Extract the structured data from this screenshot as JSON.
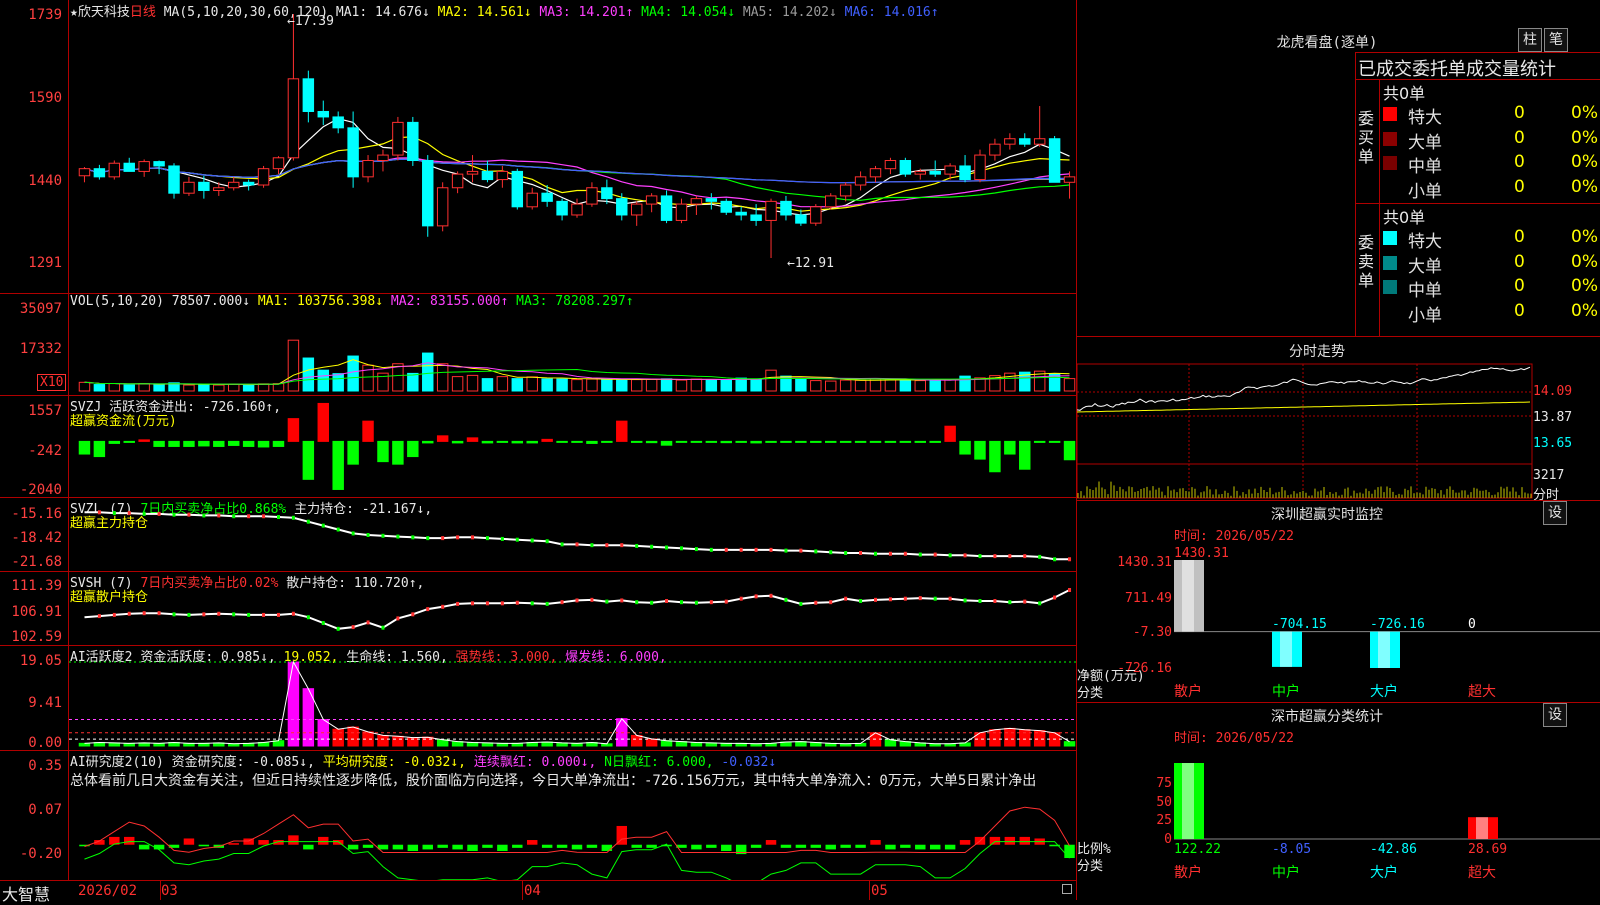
{
  "header": {
    "star": "★",
    "stock_name": "欣天科技",
    "period": "日线",
    "ma_params": "MA(5,10,20,30,60,120)",
    "ma1": "MA1: 14.676↓",
    "ma2": "MA2: 14.561↓",
    "ma3": "MA3: 14.201↑",
    "ma4": "MA4: 14.054↓",
    "ma5": "MA5: 14.202↓",
    "ma6": "MA6: 14.016↑"
  },
  "price_axis": [
    "1739",
    "1590",
    "1440",
    "1291"
  ],
  "price_annotations": {
    "high": "←17.39",
    "low": "←12.91"
  },
  "vol": {
    "head": "VOL(5,10,20)",
    "value": "78507.000↓",
    "ma1": "MA1: 103756.398↓",
    "ma2": "MA2: 83155.000↑",
    "ma3": "MA3: 78208.297↑",
    "axis": [
      "35097",
      "17332"
    ],
    "unit": "X10"
  },
  "svzj": {
    "head": "SVZJ",
    "value": "活跃资金进出: -726.160↑,",
    "subtitle": "超赢资金流(万元)",
    "axis": [
      "1557",
      "-242",
      "-2040"
    ]
  },
  "svzl": {
    "head": "SVZL (7)",
    "ratio": "7日内买卖净占比0.868%",
    "hold": "主力持仓: -21.167↓,",
    "subtitle": "超赢主力持仓",
    "axis": [
      "-15.16",
      "-18.42",
      "-21.68"
    ]
  },
  "svsh": {
    "head": "SVSH (7)",
    "ratio": "7日内买卖净占比0.02%",
    "hold": "散户持仓: 110.720↑,",
    "subtitle": "超赢散户持仓",
    "axis": [
      "111.39",
      "106.91",
      "102.59"
    ]
  },
  "ai_active": {
    "head": "AI活跃度2",
    "v1": "资金活跃度: 0.985↓,",
    "v2": "19.052,",
    "v3": "生命线: 1.560,",
    "v4": "强势线: 3.000,",
    "v5": "爆发线: 6.000,",
    "axis": [
      "19.05",
      "9.41",
      "0.00"
    ]
  },
  "ai_research": {
    "head": "AI研究度2(10)",
    "v1": "资金研究度: -0.085↓,",
    "v2": "平均研究度: -0.032↓,",
    "v3": "连续飘红: 0.000↓,",
    "v4": "N日飘红: 6.000,",
    "v5": "-0.032↓",
    "summary": "总体看前几日大资金有关注，但近日持续性逐步降低，股价面临方向选择，今日大单净流出：-726.156万元，其中特大单净流入：0万元，大单5日累计净出",
    "axis": [
      "0.35",
      "0.07",
      "-0.20"
    ]
  },
  "x_axis": {
    "brand": "大智慧",
    "labels": [
      "2026/02",
      "03",
      "04",
      "05"
    ]
  },
  "right": {
    "lhb_title": "龙虎看盘(逐单)",
    "btn_zhu": "柱",
    "btn_bi": "笔",
    "table_title": "已成交委托单成交量统计",
    "buy_label": "委买单",
    "sell_label": "委卖单",
    "buy_total": "共0单",
    "sell_total": "共0单",
    "rows": [
      "特大",
      "大单",
      "中单",
      "小单"
    ],
    "buy_colors": [
      "#ff0000",
      "#8b0000",
      "#7a0000",
      "#000000"
    ],
    "sell_colors": [
      "#00ffff",
      "#008b8b",
      "#007a7a",
      "#000000"
    ],
    "count": "0",
    "pct": "0%",
    "fenshi_title": "分时走势",
    "fenshi_axis": [
      "14.09",
      "13.87",
      "13.65",
      "3217",
      "分时"
    ],
    "sz_title": "深圳超赢实时监控",
    "sz_time": "时间: 2026/05/22",
    "sz_btn": "设",
    "sz_axis": [
      "1430.31",
      "711.49",
      "-7.30",
      "-726.16"
    ],
    "sz_unit": "净额(万元)",
    "sz_fenlei": "分类",
    "sz_values": [
      "1430.31",
      "-704.15",
      "-726.16",
      "0"
    ],
    "categories": [
      "散户",
      "中户",
      "大户",
      "超大"
    ],
    "cls_title": "深市超赢分类统计",
    "cls_time": "时间: 2026/05/22",
    "cls_btn": "设",
    "cls_axis": [
      "75",
      "50",
      "25",
      "0"
    ],
    "cls_unit": "比例%",
    "cls_fenlei": "分类",
    "cls_values": [
      "122.22",
      "-8.05",
      "-42.86",
      "28.69"
    ]
  },
  "colors": {
    "up": "#ff3030",
    "down": "#00ffff",
    "grid": "#b00000",
    "ma1": "#ffffff",
    "ma2": "#ffff00",
    "ma3": "#ff40ff",
    "ma4": "#00ff00",
    "ma5": "#a0a0a0",
    "ma6": "#4060ff"
  },
  "chart_data": [
    {
      "type": "candlestick",
      "title": "欣天科技 日线",
      "ylim": [
        12.91,
        17.39
      ],
      "ylabels": [
        "17.39",
        "15.90",
        "14.40",
        "12.91"
      ],
      "x": [
        "2026/02",
        "03",
        "04",
        "05"
      ],
      "ohlc": [
        [
          14.42,
          14.58,
          14.3,
          14.55
        ],
        [
          14.55,
          14.62,
          14.35,
          14.4
        ],
        [
          14.4,
          14.7,
          14.35,
          14.65
        ],
        [
          14.65,
          14.75,
          14.5,
          14.5
        ],
        [
          14.5,
          14.72,
          14.4,
          14.68
        ],
        [
          14.68,
          14.7,
          14.45,
          14.6
        ],
        [
          14.6,
          14.65,
          14.0,
          14.1
        ],
        [
          14.1,
          14.4,
          14.05,
          14.3
        ],
        [
          14.3,
          14.42,
          14.0,
          14.15
        ],
        [
          14.15,
          14.3,
          14.05,
          14.2
        ],
        [
          14.2,
          14.4,
          14.15,
          14.3
        ],
        [
          14.3,
          14.35,
          14.15,
          14.25
        ],
        [
          14.25,
          14.6,
          14.2,
          14.55
        ],
        [
          14.55,
          14.78,
          14.45,
          14.75
        ],
        [
          14.75,
          17.39,
          14.7,
          16.2
        ],
        [
          16.2,
          16.35,
          15.4,
          15.6
        ],
        [
          15.6,
          15.8,
          15.35,
          15.5
        ],
        [
          15.5,
          15.6,
          15.2,
          15.3
        ],
        [
          15.3,
          15.6,
          14.2,
          14.4
        ],
        [
          14.4,
          14.8,
          14.3,
          14.7
        ],
        [
          14.7,
          14.9,
          14.5,
          14.8
        ],
        [
          14.8,
          15.5,
          14.7,
          15.4
        ],
        [
          15.4,
          15.5,
          14.6,
          14.7
        ],
        [
          14.7,
          14.8,
          13.3,
          13.5
        ],
        [
          13.5,
          14.3,
          13.4,
          14.2
        ],
        [
          14.2,
          14.5,
          14.1,
          14.45
        ],
        [
          14.45,
          14.8,
          14.3,
          14.5
        ],
        [
          14.5,
          14.7,
          14.3,
          14.35
        ],
        [
          14.35,
          14.6,
          14.2,
          14.5
        ],
        [
          14.5,
          14.55,
          13.8,
          13.85
        ],
        [
          13.85,
          14.2,
          13.8,
          14.1
        ],
        [
          14.1,
          14.25,
          13.85,
          13.95
        ],
        [
          13.95,
          14.0,
          13.6,
          13.7
        ],
        [
          13.7,
          14.0,
          13.65,
          13.9
        ],
        [
          13.9,
          14.3,
          13.85,
          14.2
        ],
        [
          14.2,
          14.35,
          13.9,
          14.0
        ],
        [
          14.0,
          14.1,
          13.6,
          13.7
        ],
        [
          13.7,
          13.95,
          13.5,
          13.9
        ],
        [
          13.9,
          14.1,
          13.75,
          14.05
        ],
        [
          14.05,
          14.15,
          13.55,
          13.6
        ],
        [
          13.6,
          14.0,
          13.55,
          13.9
        ],
        [
          13.9,
          14.05,
          13.7,
          14.0
        ],
        [
          14.0,
          14.1,
          13.8,
          13.95
        ],
        [
          13.95,
          14.0,
          13.7,
          13.75
        ],
        [
          13.75,
          13.85,
          13.6,
          13.7
        ],
        [
          13.7,
          13.9,
          13.5,
          13.6
        ],
        [
          13.6,
          14.0,
          12.91,
          13.95
        ],
        [
          13.95,
          14.05,
          13.6,
          13.7
        ],
        [
          13.7,
          13.8,
          13.5,
          13.55
        ],
        [
          13.55,
          13.9,
          13.5,
          13.85
        ],
        [
          13.85,
          14.1,
          13.8,
          14.05
        ],
        [
          14.05,
          14.3,
          13.95,
          14.25
        ],
        [
          14.25,
          14.5,
          14.15,
          14.4
        ],
        [
          14.4,
          14.6,
          14.3,
          14.55
        ],
        [
          14.55,
          14.75,
          14.45,
          14.7
        ],
        [
          14.7,
          14.75,
          14.4,
          14.45
        ],
        [
          14.45,
          14.55,
          14.35,
          14.5
        ],
        [
          14.5,
          14.7,
          14.4,
          14.45
        ],
        [
          14.45,
          14.65,
          14.35,
          14.6
        ],
        [
          14.6,
          14.8,
          14.3,
          14.35
        ],
        [
          14.35,
          14.9,
          14.3,
          14.8
        ],
        [
          14.8,
          15.1,
          14.7,
          15.0
        ],
        [
          15.0,
          15.2,
          14.9,
          15.1
        ],
        [
          15.1,
          15.2,
          14.95,
          15.0
        ],
        [
          15.0,
          15.7,
          14.95,
          15.1
        ],
        [
          15.1,
          15.15,
          14.3,
          14.3
        ],
        [
          14.3,
          14.5,
          14.0,
          14.4
        ]
      ]
    },
    {
      "type": "bar",
      "title": "VOL(5,10,20)",
      "ylim": [
        0,
        35097
      ],
      "values": [
        3500,
        2600,
        3000,
        2400,
        3000,
        2600,
        3300,
        2400,
        2700,
        2400,
        2800,
        2600,
        2900,
        3000,
        20500,
        13300,
        8400,
        7000,
        14100,
        10400,
        7200,
        11000,
        7100,
        15300,
        11000,
        5800,
        6300,
        5000,
        5800,
        5000,
        5700,
        4900,
        4800,
        4600,
        4800,
        4700,
        4500,
        4600,
        4700,
        4900,
        4400,
        4800,
        4600,
        4500,
        5200,
        4700,
        8400,
        6000,
        4700,
        4200,
        4000,
        4400,
        4300,
        4900,
        4500,
        4300,
        4200,
        4400,
        4600,
        6000,
        5300,
        6200,
        7200,
        7600,
        8000,
        7000,
        5000
      ],
      "up": [
        1,
        0,
        1,
        0,
        1,
        0,
        0,
        1,
        0,
        1,
        1,
        0,
        1,
        1,
        1,
        0,
        0,
        0,
        0,
        1,
        1,
        1,
        0,
        0,
        1,
        1,
        1,
        0,
        1,
        0,
        1,
        0,
        0,
        1,
        1,
        0,
        0,
        1,
        1,
        0,
        1,
        1,
        0,
        0,
        0,
        0,
        1,
        0,
        0,
        1,
        1,
        1,
        1,
        1,
        1,
        0,
        1,
        0,
        1,
        0,
        1,
        1,
        1,
        0,
        1,
        0,
        1
      ]
    },
    {
      "type": "bar",
      "title": "超赢资金流(万元)",
      "ylim": [
        -2040,
        1557
      ],
      "values": [
        -500,
        -600,
        -80,
        -40,
        60,
        -200,
        -200,
        -200,
        -180,
        -200,
        -160,
        -200,
        -220,
        -200,
        900,
        -1500,
        1500,
        -1900,
        -900,
        800,
        -800,
        -900,
        -600,
        -60,
        220,
        -60,
        140,
        -60,
        -40,
        -60,
        -60,
        80,
        -30,
        -20,
        -80,
        -20,
        800,
        -40,
        -50,
        -150,
        -30,
        -30,
        -40,
        -50,
        -40,
        -60,
        -40,
        -30,
        -30,
        -40,
        -30,
        -30,
        -20,
        -20,
        -30,
        -30,
        -30,
        -40,
        600,
        -500,
        -700,
        -1200,
        -500,
        -1100,
        -40,
        -20,
        -726
      ]
    },
    {
      "type": "line",
      "title": "超赢主力持仓",
      "ylim": [
        -21.68,
        -15.16
      ],
      "values": [
        -15.2,
        -15.2,
        -15.3,
        -15.3,
        -15.4,
        -15.4,
        -15.5,
        -15.5,
        -15.6,
        -15.6,
        -15.7,
        -15.7,
        -15.7,
        -15.8,
        -15.9,
        -16.4,
        -16.9,
        -17.4,
        -17.9,
        -18.1,
        -18.2,
        -18.3,
        -18.4,
        -18.5,
        -18.5,
        -18.4,
        -18.4,
        -18.5,
        -18.6,
        -18.7,
        -18.8,
        -18.9,
        -19.3,
        -19.3,
        -19.4,
        -19.4,
        -19.4,
        -19.5,
        -19.6,
        -19.7,
        -19.8,
        -19.9,
        -20.0,
        -20.0,
        -20.0,
        -20.0,
        -20.0,
        -20.1,
        -20.1,
        -20.2,
        -20.3,
        -20.4,
        -20.4,
        -20.5,
        -20.5,
        -20.5,
        -20.6,
        -20.6,
        -20.7,
        -20.7,
        -20.8,
        -20.8,
        -20.8,
        -20.8,
        -20.9,
        -21.2,
        -21.2
      ]
    },
    {
      "type": "line",
      "title": "超赢散户持仓",
      "ylim": [
        102.59,
        111.39
      ],
      "values": [
        106.0,
        106.2,
        106.4,
        106.6,
        106.7,
        106.7,
        106.5,
        106.4,
        106.5,
        106.6,
        106.5,
        106.4,
        106.4,
        106.4,
        106.6,
        106.0,
        105.0,
        104.0,
        104.3,
        105.1,
        104.2,
        105.8,
        106.5,
        107.4,
        107.8,
        108.3,
        108.4,
        108.4,
        108.4,
        108.5,
        108.4,
        108.3,
        108.6,
        108.9,
        109.0,
        108.7,
        108.9,
        108.6,
        108.5,
        108.8,
        108.6,
        108.5,
        108.6,
        108.7,
        109.2,
        109.6,
        109.7,
        109.0,
        108.3,
        108.5,
        108.6,
        109.2,
        108.8,
        109.0,
        109.1,
        109.2,
        109.3,
        109.2,
        109.2,
        108.9,
        108.8,
        108.8,
        108.6,
        108.7,
        108.4,
        109.4,
        110.7
      ]
    },
    {
      "type": "bar",
      "title": "AI活跃度2",
      "ylim": [
        0,
        19.05
      ],
      "values": [
        0.6,
        0.8,
        0.7,
        0.6,
        0.7,
        0.6,
        0.8,
        0.6,
        0.6,
        0.7,
        0.5,
        0.6,
        0.8,
        1.2,
        19.05,
        13.0,
        6.0,
        3.8,
        4.3,
        3.2,
        2.4,
        2.2,
        1.9,
        2.0,
        1.4,
        1.0,
        0.8,
        0.7,
        0.6,
        0.6,
        0.8,
        0.9,
        0.7,
        0.6,
        0.8,
        0.5,
        6.2,
        2.4,
        1.6,
        1.2,
        1.0,
        0.8,
        0.7,
        0.6,
        0.6,
        0.5,
        0.6,
        0.9,
        1.0,
        0.8,
        0.6,
        0.5,
        0.6,
        3.0,
        1.4,
        1.0,
        0.7,
        0.5,
        0.5,
        0.7,
        3.0,
        3.7,
        4.0,
        3.7,
        3.5,
        3.0,
        0.985
      ],
      "lines": {
        "生命线": 1.56,
        "强势线": 3.0,
        "爆发线": 6.0
      }
    },
    {
      "type": "bar",
      "title": "AI研究度2(10)",
      "ylim": [
        -0.2,
        0.35
      ],
      "values": [
        -0.01,
        0.03,
        0.05,
        0.05,
        -0.03,
        -0.03,
        -0.02,
        0.04,
        -0.01,
        -0.02,
        0.01,
        0.04,
        0.03,
        0.03,
        0.06,
        -0.03,
        0.05,
        0.03,
        -0.03,
        -0.02,
        -0.03,
        -0.03,
        -0.04,
        -0.03,
        -0.02,
        -0.03,
        -0.04,
        -0.02,
        -0.04,
        -0.02,
        0.03,
        -0.02,
        -0.02,
        -0.03,
        -0.02,
        -0.04,
        0.12,
        -0.02,
        -0.02,
        -0.01,
        -0.02,
        -0.03,
        -0.02,
        -0.04,
        -0.06,
        -0.02,
        0.03,
        -0.02,
        -0.02,
        -0.02,
        -0.03,
        -0.02,
        -0.02,
        0.03,
        -0.03,
        -0.02,
        -0.03,
        -0.03,
        -0.03,
        0.03,
        0.05,
        0.05,
        0.05,
        0.05,
        0.04,
        -0.01,
        -0.085
      ]
    }
  ]
}
